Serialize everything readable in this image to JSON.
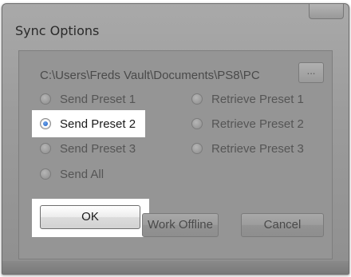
{
  "window": {
    "title": "Sync Options"
  },
  "path": {
    "text": "C:\\Users\\Freds Vault\\Documents\\PS8\\PC ",
    "browse_label": "..."
  },
  "send_options": [
    {
      "label": "Send Preset 1",
      "selected": false
    },
    {
      "label": "Send Preset 2",
      "selected": true
    },
    {
      "label": "Send Preset 3",
      "selected": false
    },
    {
      "label": "Send All",
      "selected": false
    }
  ],
  "retrieve_options": [
    {
      "label": "Retrieve Preset 1",
      "selected": false
    },
    {
      "label": "Retrieve Preset 2",
      "selected": false
    },
    {
      "label": "Retrieve Preset 3",
      "selected": false
    }
  ],
  "buttons": {
    "ok": "OK",
    "work_offline": "Work Offline",
    "cancel": "Cancel"
  },
  "colors": {
    "dialog_background": "#959595",
    "highlight": "#ffffff",
    "radio_selected": "#1c5fc4"
  }
}
